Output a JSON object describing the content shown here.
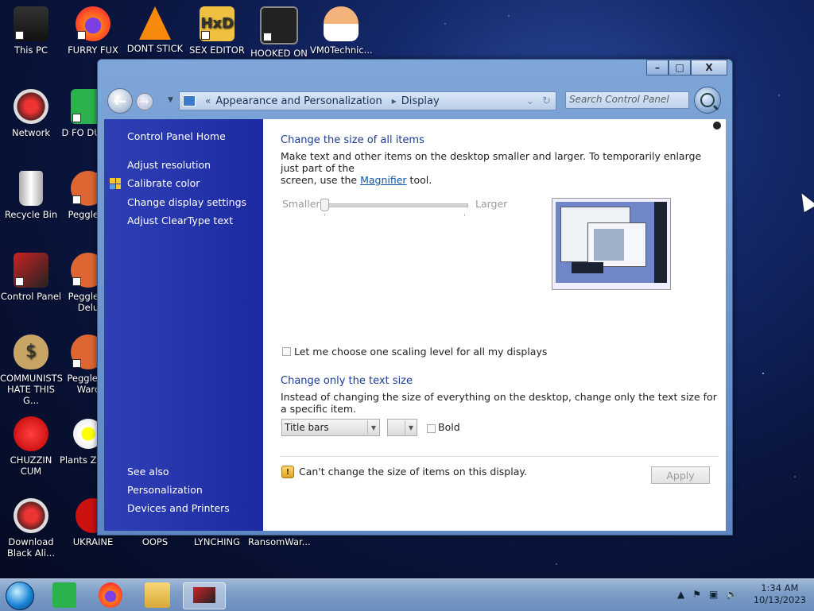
{
  "desktop": {
    "icons": [
      {
        "label": "This PC"
      },
      {
        "label": "FURRY FUX"
      },
      {
        "label": "DONT STICK"
      },
      {
        "label": "SEX EDITOR"
      },
      {
        "label": "HOOKED ON"
      },
      {
        "label": "VM0Technic..."
      },
      {
        "label": "Network"
      },
      {
        "label": "D FO DUMB"
      },
      {
        "label": "Recycle Bin"
      },
      {
        "label": "Peggle D"
      },
      {
        "label": "Control Panel"
      },
      {
        "label": "Peggle N Delu"
      },
      {
        "label": "COMMUNISTS HATE THIS G..."
      },
      {
        "label": "Peggle of Warc"
      },
      {
        "label": "CHUZZIN CUM"
      },
      {
        "label": "Plants Zomb"
      },
      {
        "label": "Download Black Ali..."
      },
      {
        "label": "UKRAINE"
      },
      {
        "label": "OOPS"
      },
      {
        "label": "LYNCHING"
      },
      {
        "label": "RansomWar..."
      }
    ]
  },
  "window": {
    "controls": {
      "minimize": "–",
      "maximize": "□",
      "close": "X"
    },
    "nav": {
      "back": "←",
      "forward": "→"
    },
    "address": {
      "separator": "«",
      "crumbs": [
        "Appearance and Personalization",
        "Display"
      ]
    },
    "search": {
      "placeholder": "Search Control Panel"
    },
    "sidebar": {
      "home": "Control Panel Home",
      "links": [
        "Adjust resolution",
        "Calibrate color",
        "Change display settings",
        "Adjust ClearType text"
      ],
      "see_also_title": "See also",
      "see_also": [
        "Personalization",
        "Devices and Printers"
      ]
    },
    "content": {
      "heading1": "Change the size of all items",
      "desc1_a": "Make text and other items on the desktop smaller and larger. To temporarily enlarge just part of the",
      "desc1_b": "screen, use the ",
      "magnifier_link": "Magnifier",
      "desc1_c": " tool.",
      "slider_min": "Smaller",
      "slider_max": "Larger",
      "slider_value": 0,
      "checkbox_label": "Let me choose one scaling level for all my displays",
      "heading2": "Change only the text size",
      "desc2": "Instead of changing the size of everything on the desktop, change only the text size for a specific item.",
      "item_select": "Title bars",
      "size_select": "",
      "bold_label": "Bold",
      "warning": "Can't change the size of items on this display.",
      "apply": "Apply"
    }
  },
  "taskbar": {
    "time": "1:34 AM",
    "date": "10/13/2023"
  }
}
